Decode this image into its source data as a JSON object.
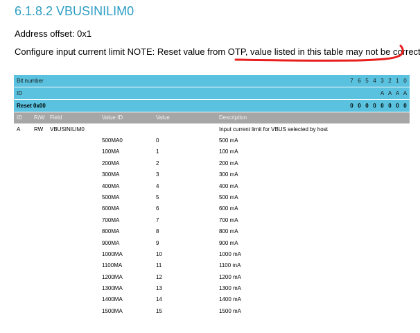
{
  "section_title": "6.1.8.2 VBUSINILIM0",
  "address_offset": "Address offset: 0x1",
  "description": "Configure input current limit NOTE: Reset value from OTP, value listed in this table may not be correct.",
  "annotation": {
    "color": "#e81e1e"
  },
  "register": {
    "bit_number_label": "Bit number",
    "id_label": "ID",
    "reset_label": "Reset 0x00",
    "bits": [
      "7",
      "6",
      "5",
      "4",
      "3",
      "2",
      "1",
      "0"
    ],
    "ids": [
      "",
      "",
      "",
      "",
      "A",
      "A",
      "A",
      "A"
    ],
    "reset_values": [
      "0",
      "0",
      "0",
      "0",
      "0",
      "0",
      "0",
      "0"
    ]
  },
  "columns": {
    "id": "ID",
    "rw": "R/W",
    "field": "Field",
    "value_id": "Value ID",
    "value": "Value",
    "description": "Description"
  },
  "field": {
    "id": "A",
    "rw": "RW",
    "name": "VBUSINILIM0",
    "description": "Input current limit for VBUS selected by host"
  },
  "values": [
    {
      "vid": "500MA0",
      "val": "0",
      "desc": "500 mA"
    },
    {
      "vid": "100MA",
      "val": "1",
      "desc": "100 mA"
    },
    {
      "vid": "200MA",
      "val": "2",
      "desc": "200 mA"
    },
    {
      "vid": "300MA",
      "val": "3",
      "desc": "300 mA"
    },
    {
      "vid": "400MA",
      "val": "4",
      "desc": "400 mA"
    },
    {
      "vid": "500MA",
      "val": "5",
      "desc": "500 mA"
    },
    {
      "vid": "600MA",
      "val": "6",
      "desc": "600 mA"
    },
    {
      "vid": "700MA",
      "val": "7",
      "desc": "700 mA"
    },
    {
      "vid": "800MA",
      "val": "8",
      "desc": "800 mA"
    },
    {
      "vid": "900MA",
      "val": "9",
      "desc": "900 mA"
    },
    {
      "vid": "1000MA",
      "val": "10",
      "desc": "1000 mA"
    },
    {
      "vid": "1100MA",
      "val": "11",
      "desc": "1100 mA"
    },
    {
      "vid": "1200MA",
      "val": "12",
      "desc": "1200 mA"
    },
    {
      "vid": "1300MA",
      "val": "13",
      "desc": "1300 mA"
    },
    {
      "vid": "1400MA",
      "val": "14",
      "desc": "1400 mA"
    },
    {
      "vid": "1500MA",
      "val": "15",
      "desc": "1500 mA"
    }
  ]
}
